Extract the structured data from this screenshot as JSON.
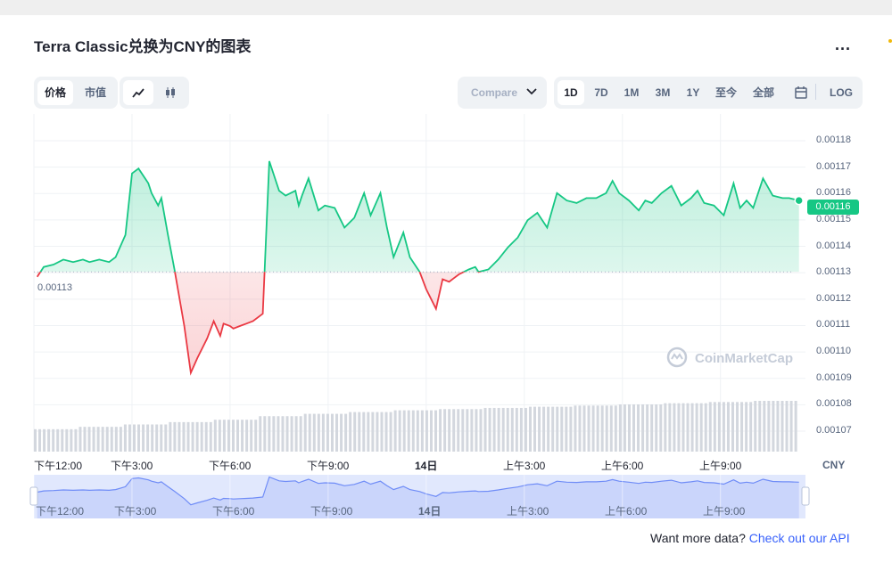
{
  "header": {
    "title": "Terra Classic兑换为CNY的图表",
    "more_label": "..."
  },
  "toolbar": {
    "metric_tabs": [
      "价格",
      "市值"
    ],
    "compare_label": "Compare",
    "ranges": [
      "1D",
      "7D",
      "1M",
      "3M",
      "1Y",
      "至今",
      "全部"
    ],
    "log_label": "LOG"
  },
  "chart_data": {
    "type": "line",
    "currency": "CNY",
    "reference_value": 0.00113,
    "reference_label": "0.00113",
    "current_value": 0.00116,
    "current_label": "0.00116",
    "up_color": "#16c784",
    "down_color": "#ea3943",
    "ylim": [
      0.0010653,
      0.0011833
    ],
    "yticks": [
      "0.00118",
      "0.00117",
      "0.00116",
      "0.00115",
      "0.00114",
      "0.00113",
      "0.00112",
      "0.00111",
      "0.00110",
      "0.00109",
      "0.00108",
      "0.00107"
    ],
    "x_tick_labels": [
      "下午12:00",
      "下午3:00",
      "下午6:00",
      "下午9:00",
      "14日",
      "上午3:00",
      "上午6:00",
      "上午9:00"
    ],
    "x_tick_bold": [
      false,
      false,
      false,
      false,
      true,
      false,
      false,
      false
    ],
    "x_hours": [
      12,
      15,
      18,
      21,
      24,
      27,
      30,
      33
    ],
    "x_range_hours": [
      12.0,
      35.6
    ],
    "series": [
      {
        "x": [
          12.1,
          12.3,
          12.6,
          12.9,
          13.2,
          13.5,
          13.7,
          14.0,
          14.3,
          14.5,
          14.8,
          15.0,
          15.2,
          15.5,
          15.6,
          15.8,
          15.9,
          16.1,
          16.3,
          16.6,
          16.8,
          17.0,
          17.3,
          17.5,
          17.7,
          17.8,
          18.0,
          18.1,
          18.3,
          18.5,
          18.7,
          19.0,
          19.2,
          19.5,
          19.7,
          20.0,
          20.1,
          20.2,
          20.4,
          20.7,
          20.9,
          21.2,
          21.5,
          21.8,
          22.1,
          22.3,
          22.6,
          22.8,
          23.0,
          23.3,
          23.5,
          23.8,
          24.0,
          24.3,
          24.5,
          24.7,
          25.0,
          25.3,
          25.5,
          25.6,
          25.9,
          26.2,
          26.5,
          26.8,
          27.1,
          27.4,
          27.7,
          28.0,
          28.3,
          28.6,
          28.9,
          29.2,
          29.5,
          29.7,
          29.9,
          30.2,
          30.5,
          30.7,
          30.9,
          31.2,
          31.5,
          31.8,
          32.1,
          32.3,
          32.5,
          32.8,
          33.1,
          33.4,
          33.6,
          33.8,
          34.0,
          34.3,
          34.6,
          34.9,
          35.1,
          35.4
        ],
        "y": [
          0.001128,
          0.001132,
          0.001133,
          0.001135,
          0.001134,
          0.001135,
          0.001134,
          0.001135,
          0.001134,
          0.001136,
          0.001145,
          0.00117,
          0.001172,
          0.001166,
          0.001162,
          0.001157,
          0.00116,
          0.001145,
          0.001131,
          0.001108,
          0.001089,
          0.001095,
          0.001103,
          0.00111,
          0.001104,
          0.001109,
          0.001108,
          0.001107,
          0.001108,
          0.001109,
          0.00111,
          0.001113,
          0.001175,
          0.001163,
          0.001161,
          0.001163,
          0.001157,
          0.001161,
          0.001168,
          0.001155,
          0.001157,
          0.001156,
          0.001148,
          0.001152,
          0.001162,
          0.001153,
          0.001162,
          0.001148,
          0.001136,
          0.001146,
          0.001136,
          0.00113,
          0.001123,
          0.001115,
          0.001127,
          0.001126,
          0.001129,
          0.001131,
          0.001132,
          0.00113,
          0.001131,
          0.001135,
          0.00114,
          0.001144,
          0.001151,
          0.001154,
          0.001148,
          0.001162,
          0.001159,
          0.001158,
          0.00116,
          0.00116,
          0.001162,
          0.001167,
          0.001162,
          0.001159,
          0.001155,
          0.001159,
          0.001158,
          0.001162,
          0.001165,
          0.001157,
          0.00116,
          0.001163,
          0.001158,
          0.001157,
          0.001153,
          0.001166,
          0.001156,
          0.001159,
          0.001156,
          0.001168,
          0.001161,
          0.00116,
          0.00116,
          0.001159
        ]
      }
    ],
    "volume_level": [
      0.38,
      0.42,
      0.46,
      0.5,
      0.54,
      0.6,
      0.64,
      0.67,
      0.7,
      0.72,
      0.74,
      0.76,
      0.78,
      0.8,
      0.82,
      0.84,
      0.86
    ]
  },
  "navigator": {
    "labels": [
      "下午12:00",
      "下午3:00",
      "下午6:00",
      "下午9:00",
      "14日",
      "上午3:00",
      "上午6:00",
      "上午9:00"
    ]
  },
  "watermark": "CoinMarketCap",
  "footer": {
    "prefix": "Want more data?",
    "link": "Check out our API"
  }
}
